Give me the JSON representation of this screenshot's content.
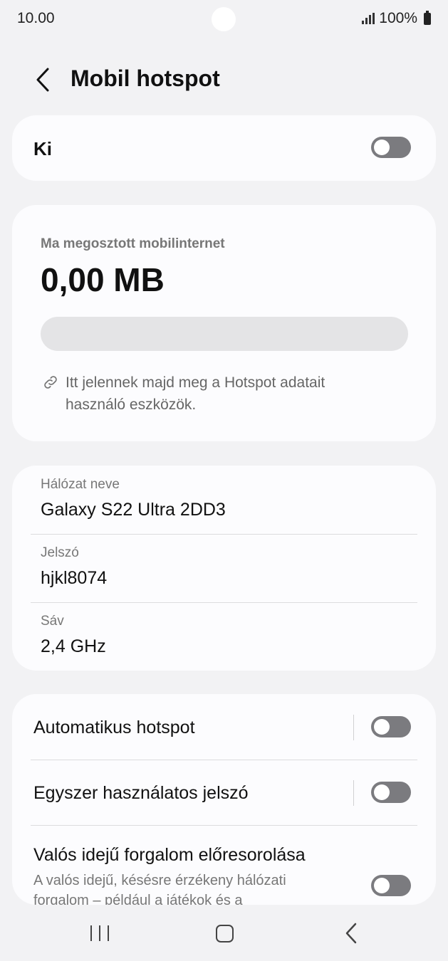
{
  "status_bar": {
    "time": "10.00",
    "battery": "100%"
  },
  "header": {
    "title": "Mobil hotspot"
  },
  "master_switch": {
    "label": "Ki",
    "enabled": false
  },
  "usage": {
    "label": "Ma megosztott mobilinternet",
    "value": "0,00 MB",
    "progress_fraction": 0,
    "note": "Itt jelennek majd meg a Hotspot adatait használó eszközök."
  },
  "network": {
    "name_label": "Hálózat neve",
    "name_value": "Galaxy S22 Ultra 2DD3",
    "password_label": "Jelszó",
    "password_value": "hjkl8074",
    "band_label": "Sáv",
    "band_value": "2,4 GHz"
  },
  "options": {
    "auto_hotspot": {
      "label": "Automatikus hotspot",
      "enabled": false
    },
    "one_time_password": {
      "label": "Egyszer használatos jelszó",
      "enabled": false
    },
    "realtime_priority": {
      "label": "Valós idejű forgalom előresorolása",
      "description": "A valós idejű, késésre érzékeny hálózati forgalom – például a játékok és a",
      "enabled": false
    }
  },
  "icons": {
    "back": "chevron-left-icon",
    "link": "link-icon",
    "nav_recents": "recents-icon",
    "nav_home": "home-icon",
    "nav_back": "back-icon"
  },
  "colors": {
    "background": "#f2f2f4",
    "card": "#fcfcfe",
    "toggle_off": "#7b7b7f"
  }
}
